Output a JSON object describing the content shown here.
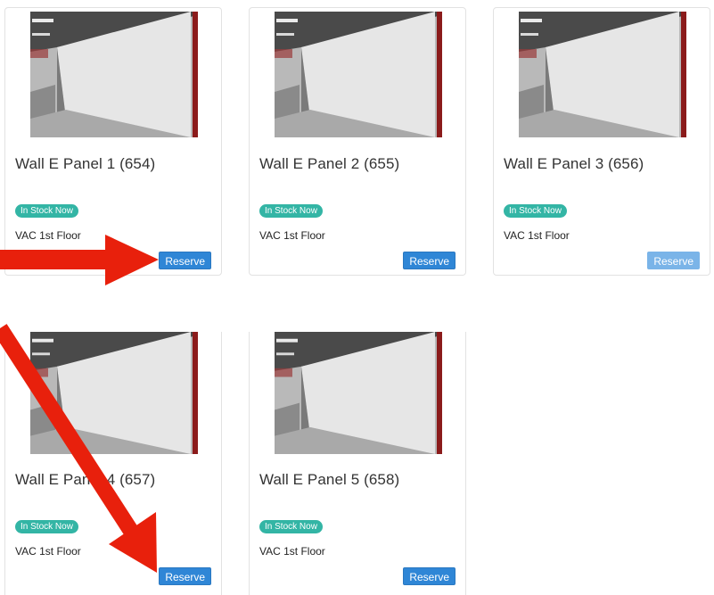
{
  "items": [
    {
      "title": "Wall E Panel 1 (654)",
      "badge": "In Stock Now",
      "location": "VAC 1st Floor",
      "button": "Reserve"
    },
    {
      "title": "Wall E Panel 2 (655)",
      "badge": "In Stock Now",
      "location": "VAC 1st Floor",
      "button": "Reserve"
    },
    {
      "title": "Wall E Panel 3 (656)",
      "badge": "In Stock Now",
      "location": "VAC 1st Floor",
      "button": "Reserve"
    },
    {
      "title": "Wall E Panel 4 (657)",
      "badge": "In Stock Now",
      "location": "VAC 1st Floor",
      "button": "Reserve"
    },
    {
      "title": "Wall E Panel 5 (658)",
      "badge": "In Stock Now",
      "location": "VAC 1st Floor",
      "button": "Reserve"
    }
  ],
  "colors": {
    "badge": "#33b5a5",
    "button": "#2f86d6",
    "button_disabled": "#7ab4e8",
    "annotation_arrow": "#e8200c"
  },
  "icons": {
    "annotation": "red-arrow-icon"
  }
}
